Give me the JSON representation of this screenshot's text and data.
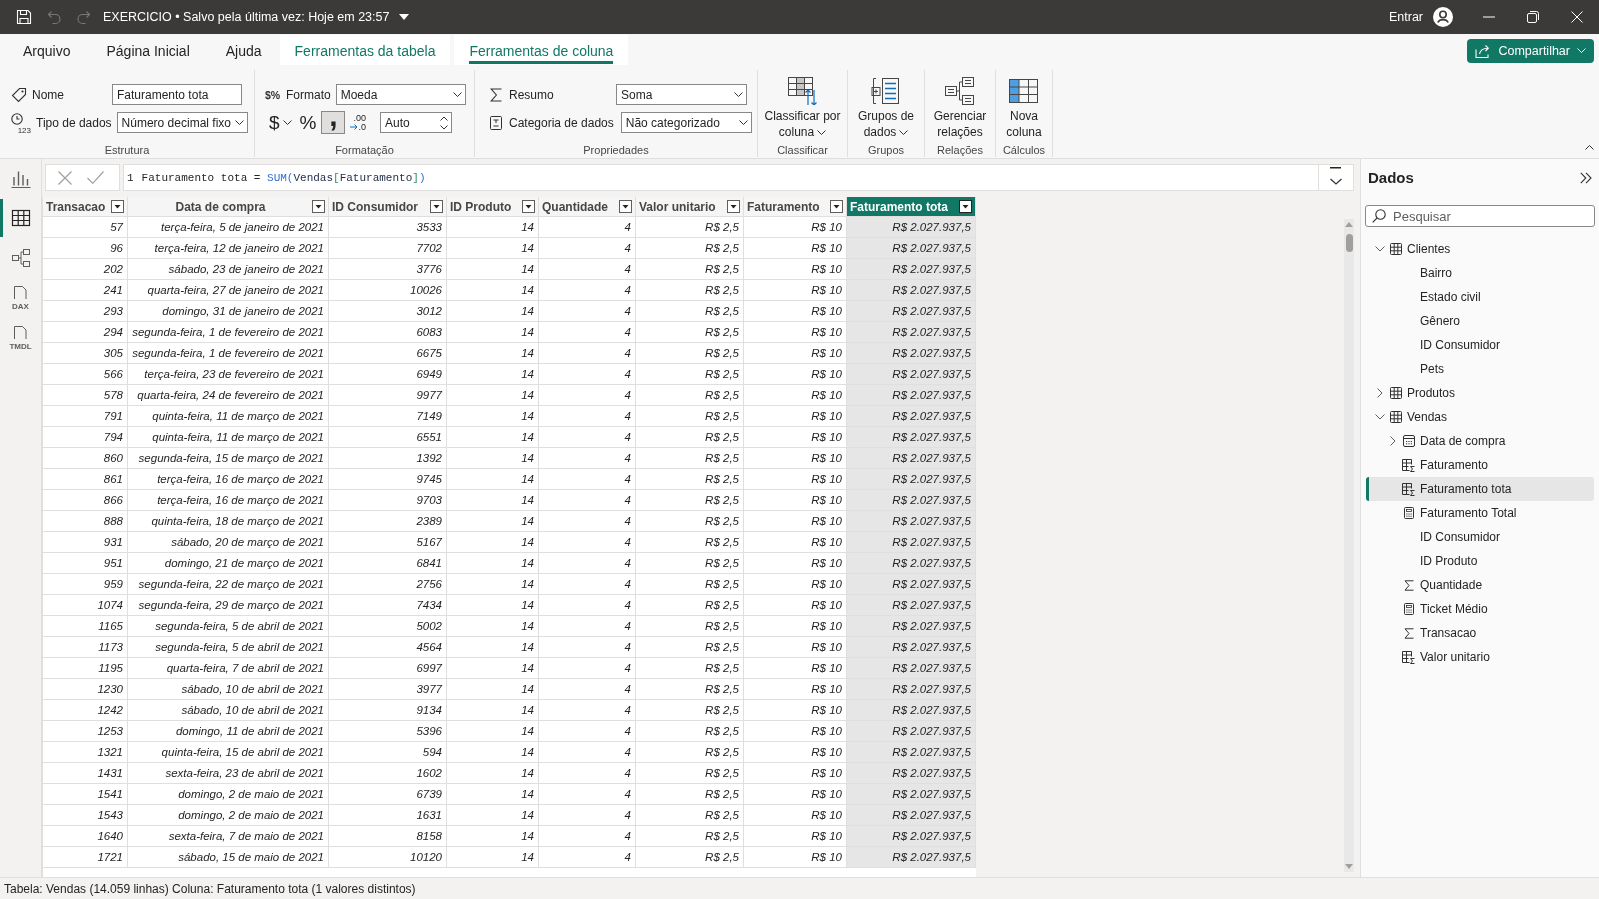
{
  "title_bar": {
    "quick_access": [
      {
        "kind": "save",
        "disabled": false
      },
      {
        "kind": "undo",
        "disabled": true
      },
      {
        "kind": "redo",
        "disabled": true
      }
    ],
    "title": "EXERCICIO • Salvo pela última vez: Hoje em 23:57",
    "sign_in": "Entrar"
  },
  "ribbon": {
    "tabs": [
      {
        "label": "Arquivo",
        "kind": "standard",
        "selected": false
      },
      {
        "label": "Página Inicial",
        "kind": "standard",
        "selected": false
      },
      {
        "label": "Ajuda",
        "kind": "standard",
        "selected": false
      },
      {
        "label": "Ferramentas da tabela",
        "kind": "contextual",
        "selected": false
      },
      {
        "label": "Ferramentas de coluna",
        "kind": "contextual",
        "selected": true
      }
    ],
    "share_button": "Compartilhar",
    "structure": {
      "label": "Estrutura",
      "name_label": "Nome",
      "name_value": "Faturamento tota",
      "data_type_icon_text": "123",
      "data_type_label": "Tipo de dados",
      "data_type_value": "Número decimal fixo"
    },
    "formatting": {
      "label": "Formatação",
      "format_icon_text": "$%",
      "format_label": "Formato",
      "format_value": "Moeda",
      "buttons": [
        {
          "kind": "currency",
          "glyph": "$",
          "has_menu": true,
          "pressed": false
        },
        {
          "kind": "percent",
          "glyph": "%",
          "has_menu": false,
          "pressed": false
        },
        {
          "kind": "thousands",
          "glyph": ",",
          "has_menu": false,
          "pressed": true
        },
        {
          "kind": "decimals",
          "glyph": ".00",
          "glyph_low": ".0",
          "has_menu": false,
          "pressed": false
        }
      ],
      "decimal_places": "Auto"
    },
    "properties": {
      "label": "Propriedades",
      "summarization_label": "Resumo",
      "summarization_value": "Soma",
      "category_label": "Categoria de dados",
      "category_value": "Não categorizado"
    },
    "command_groups": [
      {
        "label": "Classificar",
        "button": {
          "kind": "sort",
          "label": "Classificar por coluna",
          "has_menu": true
        }
      },
      {
        "label": "Grupos",
        "button": {
          "kind": "groups",
          "label": "Grupos de dados",
          "has_menu": true
        }
      },
      {
        "label": "Relações",
        "button": {
          "kind": "relationships",
          "label": "Gerenciar relações",
          "has_menu": false
        }
      },
      {
        "label": "Cálculos",
        "button": {
          "kind": "new_column",
          "label": "Nova coluna",
          "has_menu": false
        }
      }
    ]
  },
  "views": [
    {
      "kind": "report",
      "selected": false
    },
    {
      "kind": "table",
      "selected": true
    },
    {
      "kind": "model",
      "selected": false
    },
    {
      "kind": "dax",
      "icon_text": "DAX",
      "selected": false
    },
    {
      "kind": "tmdl",
      "icon_text": "TMDL",
      "selected": false
    }
  ],
  "formula_bar": {
    "actions": [
      {
        "kind": "cancel",
        "disabled": true
      },
      {
        "kind": "commit",
        "disabled": true
      }
    ],
    "line_number": "1",
    "tokens": [
      {
        "kind": "text",
        "text": "Faturamento tota = "
      },
      {
        "kind": "function",
        "text": "SUM("
      },
      {
        "kind": "table",
        "text": "Vendas"
      },
      {
        "kind": "bracket",
        "text": "["
      },
      {
        "kind": "column",
        "text": "Faturamento"
      },
      {
        "kind": "bracket",
        "text": "]"
      },
      {
        "kind": "function",
        "text": ")"
      }
    ],
    "expanded": false
  },
  "table": {
    "columns": [
      {
        "label": "Transacao",
        "selected": false
      },
      {
        "label": "Data de compra",
        "selected": false
      },
      {
        "label": "ID Consumidor",
        "selected": false
      },
      {
        "label": "ID Produto",
        "selected": false
      },
      {
        "label": "Quantidade",
        "selected": false
      },
      {
        "label": "Valor unitario",
        "selected": false
      },
      {
        "label": "Faturamento",
        "selected": false
      },
      {
        "label": "Faturamento tota",
        "selected": true
      }
    ],
    "rows": [
      [
        "57",
        "terça-feira, 5 de janeiro de 2021",
        "3533",
        "14",
        "4",
        "R$ 2,5",
        "R$ 10",
        "R$ 2.027.937,5"
      ],
      [
        "96",
        "terça-feira, 12 de janeiro de 2021",
        "7702",
        "14",
        "4",
        "R$ 2,5",
        "R$ 10",
        "R$ 2.027.937,5"
      ],
      [
        "202",
        "sábado, 23 de janeiro de 2021",
        "3776",
        "14",
        "4",
        "R$ 2,5",
        "R$ 10",
        "R$ 2.027.937,5"
      ],
      [
        "241",
        "quarta-feira, 27 de janeiro de 2021",
        "10026",
        "14",
        "4",
        "R$ 2,5",
        "R$ 10",
        "R$ 2.027.937,5"
      ],
      [
        "293",
        "domingo, 31 de janeiro de 2021",
        "3012",
        "14",
        "4",
        "R$ 2,5",
        "R$ 10",
        "R$ 2.027.937,5"
      ],
      [
        "294",
        "segunda-feira, 1 de fevereiro de 2021",
        "6083",
        "14",
        "4",
        "R$ 2,5",
        "R$ 10",
        "R$ 2.027.937,5"
      ],
      [
        "305",
        "segunda-feira, 1 de fevereiro de 2021",
        "6675",
        "14",
        "4",
        "R$ 2,5",
        "R$ 10",
        "R$ 2.027.937,5"
      ],
      [
        "566",
        "terça-feira, 23 de fevereiro de 2021",
        "6949",
        "14",
        "4",
        "R$ 2,5",
        "R$ 10",
        "R$ 2.027.937,5"
      ],
      [
        "578",
        "quarta-feira, 24 de fevereiro de 2021",
        "9977",
        "14",
        "4",
        "R$ 2,5",
        "R$ 10",
        "R$ 2.027.937,5"
      ],
      [
        "791",
        "quinta-feira, 11 de março de 2021",
        "7149",
        "14",
        "4",
        "R$ 2,5",
        "R$ 10",
        "R$ 2.027.937,5"
      ],
      [
        "794",
        "quinta-feira, 11 de março de 2021",
        "6551",
        "14",
        "4",
        "R$ 2,5",
        "R$ 10",
        "R$ 2.027.937,5"
      ],
      [
        "860",
        "segunda-feira, 15 de março de 2021",
        "1392",
        "14",
        "4",
        "R$ 2,5",
        "R$ 10",
        "R$ 2.027.937,5"
      ],
      [
        "861",
        "terça-feira, 16 de março de 2021",
        "9745",
        "14",
        "4",
        "R$ 2,5",
        "R$ 10",
        "R$ 2.027.937,5"
      ],
      [
        "866",
        "terça-feira, 16 de março de 2021",
        "9703",
        "14",
        "4",
        "R$ 2,5",
        "R$ 10",
        "R$ 2.027.937,5"
      ],
      [
        "888",
        "quinta-feira, 18 de março de 2021",
        "2389",
        "14",
        "4",
        "R$ 2,5",
        "R$ 10",
        "R$ 2.027.937,5"
      ],
      [
        "931",
        "sábado, 20 de março de 2021",
        "5167",
        "14",
        "4",
        "R$ 2,5",
        "R$ 10",
        "R$ 2.027.937,5"
      ],
      [
        "951",
        "domingo, 21 de março de 2021",
        "6841",
        "14",
        "4",
        "R$ 2,5",
        "R$ 10",
        "R$ 2.027.937,5"
      ],
      [
        "959",
        "segunda-feira, 22 de março de 2021",
        "2756",
        "14",
        "4",
        "R$ 2,5",
        "R$ 10",
        "R$ 2.027.937,5"
      ],
      [
        "1074",
        "segunda-feira, 29 de março de 2021",
        "7434",
        "14",
        "4",
        "R$ 2,5",
        "R$ 10",
        "R$ 2.027.937,5"
      ],
      [
        "1165",
        "segunda-feira, 5 de abril de 2021",
        "5002",
        "14",
        "4",
        "R$ 2,5",
        "R$ 10",
        "R$ 2.027.937,5"
      ],
      [
        "1173",
        "segunda-feira, 5 de abril de 2021",
        "4564",
        "14",
        "4",
        "R$ 2,5",
        "R$ 10",
        "R$ 2.027.937,5"
      ],
      [
        "1195",
        "quarta-feira, 7 de abril de 2021",
        "6997",
        "14",
        "4",
        "R$ 2,5",
        "R$ 10",
        "R$ 2.027.937,5"
      ],
      [
        "1230",
        "sábado, 10 de abril de 2021",
        "3977",
        "14",
        "4",
        "R$ 2,5",
        "R$ 10",
        "R$ 2.027.937,5"
      ],
      [
        "1242",
        "sábado, 10 de abril de 2021",
        "9134",
        "14",
        "4",
        "R$ 2,5",
        "R$ 10",
        "R$ 2.027.937,5"
      ],
      [
        "1253",
        "domingo, 11 de abril de 2021",
        "5396",
        "14",
        "4",
        "R$ 2,5",
        "R$ 10",
        "R$ 2.027.937,5"
      ],
      [
        "1321",
        "quinta-feira, 15 de abril de 2021",
        "594",
        "14",
        "4",
        "R$ 2,5",
        "R$ 10",
        "R$ 2.027.937,5"
      ],
      [
        "1431",
        "sexta-feira, 23 de abril de 2021",
        "1602",
        "14",
        "4",
        "R$ 2,5",
        "R$ 10",
        "R$ 2.027.937,5"
      ],
      [
        "1541",
        "domingo, 2 de maio de 2021",
        "6739",
        "14",
        "4",
        "R$ 2,5",
        "R$ 10",
        "R$ 2.027.937,5"
      ],
      [
        "1543",
        "domingo, 2 de maio de 2021",
        "1631",
        "14",
        "4",
        "R$ 2,5",
        "R$ 10",
        "R$ 2.027.937,5"
      ],
      [
        "1640",
        "sexta-feira, 7 de maio de 2021",
        "8158",
        "14",
        "4",
        "R$ 2,5",
        "R$ 10",
        "R$ 2.027.937,5"
      ],
      [
        "1721",
        "sábado, 15 de maio de 2021",
        "10120",
        "14",
        "4",
        "R$ 2,5",
        "R$ 10",
        "R$ 2.027.937,5"
      ]
    ]
  },
  "data_pane": {
    "title": "Dados",
    "search_placeholder": "Pesquisar",
    "tree": [
      {
        "label": "Clientes",
        "kind": "table",
        "expanded": true,
        "selected": false,
        "children": [
          {
            "label": "Bairro",
            "kind": "column",
            "selected": false
          },
          {
            "label": "Estado civil",
            "kind": "column",
            "selected": false
          },
          {
            "label": "Gênero",
            "kind": "column",
            "selected": false
          },
          {
            "label": "ID Consumidor",
            "kind": "column",
            "selected": false
          },
          {
            "label": "Pets",
            "kind": "column",
            "selected": false
          }
        ]
      },
      {
        "label": "Produtos",
        "kind": "table",
        "expanded": false,
        "selected": false
      },
      {
        "label": "Vendas",
        "kind": "table",
        "expanded": true,
        "selected": false,
        "children": [
          {
            "label": "Data de compra",
            "kind": "date",
            "expanded": false,
            "selected": false
          },
          {
            "label": "Faturamento",
            "kind": "calculated",
            "selected": false
          },
          {
            "label": "Faturamento tota",
            "kind": "calculated",
            "selected": true
          },
          {
            "label": "Faturamento Total",
            "kind": "measure",
            "selected": false
          },
          {
            "label": "ID Consumidor",
            "kind": "column",
            "selected": false
          },
          {
            "label": "ID Produto",
            "kind": "column",
            "selected": false
          },
          {
            "label": "Quantidade",
            "kind": "sum",
            "selected": false
          },
          {
            "label": "Ticket Médio",
            "kind": "measure",
            "selected": false
          },
          {
            "label": "Transacao",
            "kind": "sum",
            "selected": false
          },
          {
            "label": "Valor unitario",
            "kind": "calculated",
            "selected": false
          }
        ]
      }
    ]
  },
  "status_bar": "Tabela: Vendas (14.059 linhas) Coluna: Faturamento tota (1 valores distintos)"
}
